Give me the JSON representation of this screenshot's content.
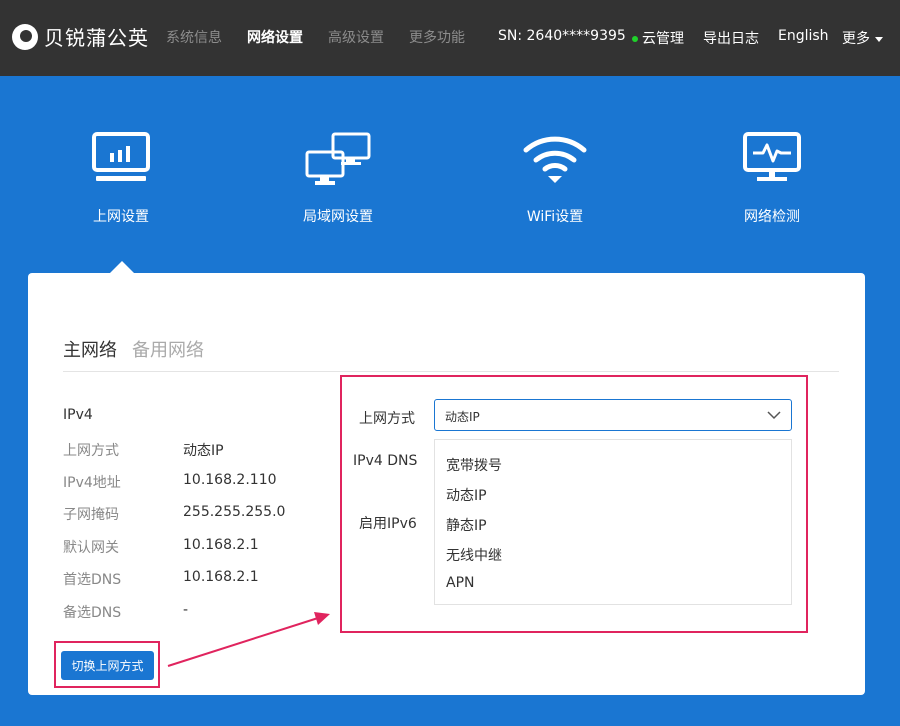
{
  "header": {
    "brand": "贝锐蒲公英",
    "nav": [
      "系统信息",
      "网络设置",
      "高级设置",
      "更多功能"
    ],
    "sn": "SN: 2640****9395",
    "cloud": "云管理",
    "export_log": "导出日志",
    "language": "English",
    "more": "更多"
  },
  "categories": [
    "上网设置",
    "局域网设置",
    "WiFi设置",
    "网络检测"
  ],
  "tabs": {
    "main": "主网络",
    "backup": "备用网络"
  },
  "info": {
    "title": "IPv4",
    "rows": [
      {
        "key": "上网方式",
        "value": "动态IP"
      },
      {
        "key": "IPv4地址",
        "value": "10.168.2.110"
      },
      {
        "key": "子网掩码",
        "value": "255.255.255.0"
      },
      {
        "key": "默认网关",
        "value": "10.168.2.1"
      },
      {
        "key": "首选DNS",
        "value": "10.168.2.1"
      },
      {
        "key": "备选DNS",
        "value": "-"
      }
    ]
  },
  "switch_button": "切换上网方式",
  "form": {
    "mode_label": "上网方式",
    "dns_label": "IPv4 DNS",
    "ipv6_label": "启用IPv6",
    "selected": "动态IP",
    "options": [
      "宽带拨号",
      "动态IP",
      "静态IP",
      "无线中继",
      "APN"
    ]
  },
  "colors": {
    "accent": "#1a76d2",
    "topbar": "#333333",
    "highlight": "#e0245e",
    "cloud_dot": "#1fd12a"
  }
}
